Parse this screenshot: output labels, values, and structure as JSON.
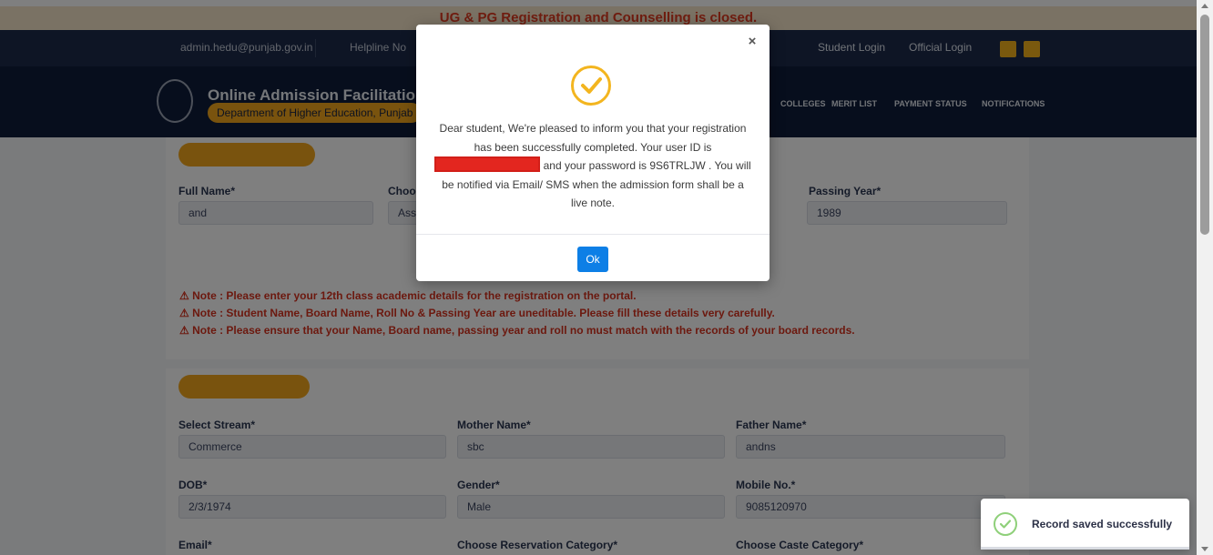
{
  "announcement": "UG & PG Registration and Counselling is closed.",
  "topbar": {
    "email": "admin.hedu@punjab.gov.in",
    "helpline": "Helpline No",
    "student_login": "Student Login",
    "official_login": "Official Login"
  },
  "header": {
    "brand": "Online Admission Facilitation Portal",
    "department": "Department of Higher Education, Punjab",
    "nav": [
      "COLLEGES",
      "MERIT LIST",
      "PAYMENT STATUS",
      "NOTIFICATIONS"
    ]
  },
  "form": {
    "section1_fields": [
      {
        "label": "Full Name*",
        "value": "and"
      },
      {
        "label": "Choose",
        "value": "Assa"
      },
      {
        "label": "Passing Year*",
        "value": "1989"
      }
    ],
    "notes": [
      "Note : Please enter your 12th class academic details for the registration on the portal.",
      "Note : Student Name, Board Name, Roll No & Passing Year are uneditable. Please fill these details very carefully.",
      "Note : Please ensure that your Name, Board name, passing year and roll no must match with the records of your board records."
    ],
    "section2_fields": [
      {
        "label": "Select Stream*",
        "value": "Commerce"
      },
      {
        "label": "Mother Name*",
        "value": "sbc"
      },
      {
        "label": "Father Name*",
        "value": "andns"
      },
      {
        "label": "DOB*",
        "value": "2/3/1974"
      },
      {
        "label": "Gender*",
        "value": "Male"
      },
      {
        "label": "Mobile No.*",
        "value": "9085120970"
      },
      {
        "label": "Email*",
        "value": ""
      },
      {
        "label": "Choose Reservation Category*",
        "value": ""
      },
      {
        "label": "Choose Caste Category*",
        "value": ""
      }
    ]
  },
  "modal": {
    "close_glyph": "×",
    "message_part1": "Dear student, We're pleased to inform you that your registration has been successfully completed. Your user ID is",
    "message_part2": "and your password is 9S6TRLJW . You will be notified via Email/ SMS when the admission form shall be a live note.",
    "ok_label": "Ok"
  },
  "toast": {
    "text": "Record saved successfully"
  },
  "colors": {
    "accent": "#f3b51f",
    "primary_button": "#0d7fe6",
    "redaction": "#e3261f",
    "success": "#8fd07a"
  }
}
